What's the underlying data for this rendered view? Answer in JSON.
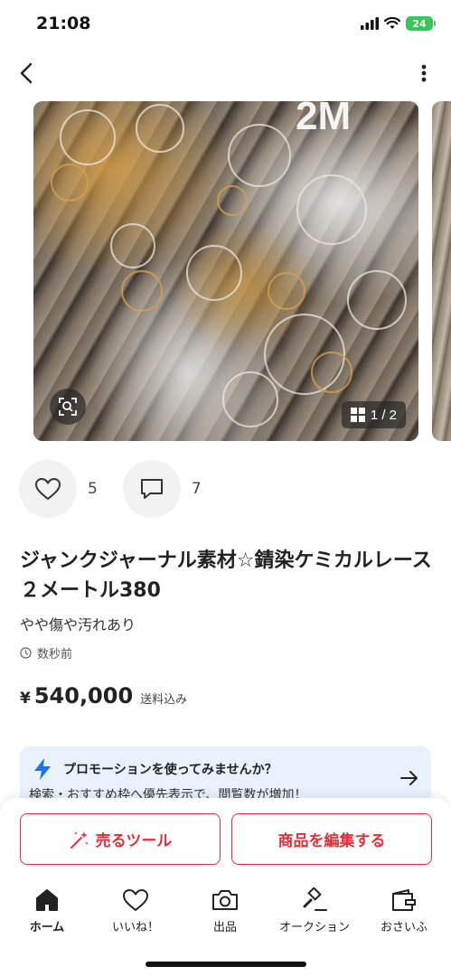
{
  "status_bar": {
    "time": "21:08",
    "battery": "24"
  },
  "carousel": {
    "overlay_text": "2M",
    "page_indicator": "1 / 2"
  },
  "actions": {
    "likes": "5",
    "comments": "7"
  },
  "item": {
    "title": "ジャンクジャーナル素材☆錆染ケミカルレース２メートル380",
    "condition": "やや傷や汚れあり",
    "posted": "数秒前",
    "price_symbol": "¥",
    "price": "540,000",
    "shipping": "送料込み"
  },
  "promotion": {
    "title": "プロモーションを使ってみませんか？",
    "subtitle": "検索・おすすめ枠へ優先表示で、閲覧数が増加！",
    "accent": "#1a73e8"
  },
  "buttons": {
    "sell_tools": "売るツール",
    "edit_item": "商品を編集する",
    "accent": "#e0313b"
  },
  "tabs": [
    {
      "label": "ホーム",
      "icon": "home-icon"
    },
    {
      "label": "いいね！",
      "icon": "heart-icon"
    },
    {
      "label": "出品",
      "icon": "camera-icon"
    },
    {
      "label": "オークション",
      "icon": "gavel-icon"
    },
    {
      "label": "おさいふ",
      "icon": "wallet-icon"
    }
  ]
}
